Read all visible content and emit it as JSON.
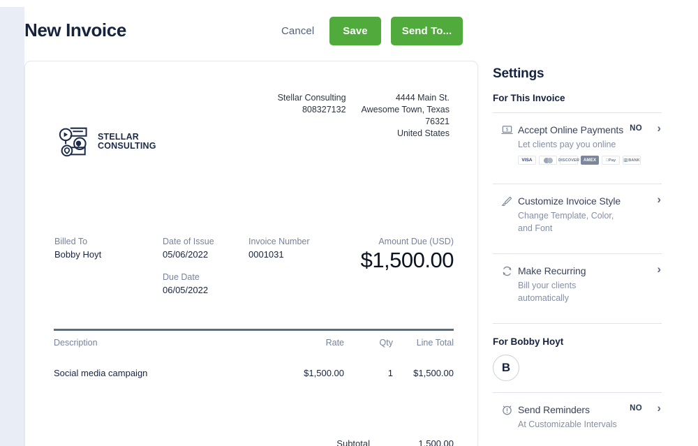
{
  "window": {
    "title": "New Invoice"
  },
  "toolbar": {
    "cancel_label": "Cancel",
    "save_label": "Save",
    "send_label": "Send To..."
  },
  "invoice": {
    "from": {
      "company": "Stellar Consulting",
      "tax_id": "808327132",
      "address_line1": "4444 Main St.",
      "address_line2": "Awesome Town, Texas",
      "postal_code": "76321",
      "country": "United States"
    },
    "logo": {
      "icon": "social-media-logo-icon",
      "line1": "STELLAR",
      "line2": "CONSULTING"
    },
    "meta": {
      "billed_to_label": "Billed To",
      "billed_to_value": "Bobby Hoyt",
      "date_of_issue_label": "Date of Issue",
      "date_of_issue_value": "05/06/2022",
      "due_date_label": "Due Date",
      "due_date_value": "06/05/2022",
      "invoice_number_label": "Invoice Number",
      "invoice_number_value": "0001031",
      "amount_due_label": "Amount Due (USD)",
      "amount_due_value": "$1,500.00"
    },
    "table": {
      "headers": {
        "description": "Description",
        "rate": "Rate",
        "qty": "Qty",
        "line_total": "Line Total"
      },
      "rows": [
        {
          "description": "Social media campaign",
          "rate": "$1,500.00",
          "qty": "1",
          "line_total": "$1,500.00"
        }
      ],
      "subtotal_label": "Subtotal",
      "subtotal_value": "1,500.00"
    }
  },
  "settings": {
    "title": "Settings",
    "section_invoice_label": "For This Invoice",
    "rows": [
      {
        "icon": "laptop-payment-icon",
        "title": "Accept Online Payments",
        "desc": "Let clients pay you online",
        "badge": "NO",
        "chevron": "›"
      },
      {
        "icon": "paintbrush-icon",
        "title": "Customize Invoice Style",
        "desc": "Change Template, Color, and Font",
        "badge": "",
        "chevron": "›"
      },
      {
        "icon": "refresh-recurring-icon",
        "title": "Make Recurring",
        "desc": "Bill your clients automatically",
        "badge": "",
        "chevron": "›"
      }
    ],
    "payment_methods": [
      {
        "name": "VISA",
        "selected": false
      },
      {
        "name": "mastercard",
        "selected": false
      },
      {
        "name": "DISCOVER",
        "selected": false
      },
      {
        "name": "AMEX",
        "selected": true
      },
      {
        "name": "Pay",
        "selected": false
      },
      {
        "name": "BANK",
        "selected": false
      }
    ],
    "section_client_label": "For Bobby Hoyt",
    "client_avatar_initial": "B",
    "client_rows": [
      {
        "icon": "alarm-clock-icon",
        "title": "Send Reminders",
        "desc": "At Customizable Intervals",
        "badge": "NO",
        "chevron": "›"
      }
    ]
  },
  "colors": {
    "accent_green": "#50aa3c",
    "navy": "#16233f",
    "rail": "#e9edf6",
    "muted": "#76839a"
  }
}
